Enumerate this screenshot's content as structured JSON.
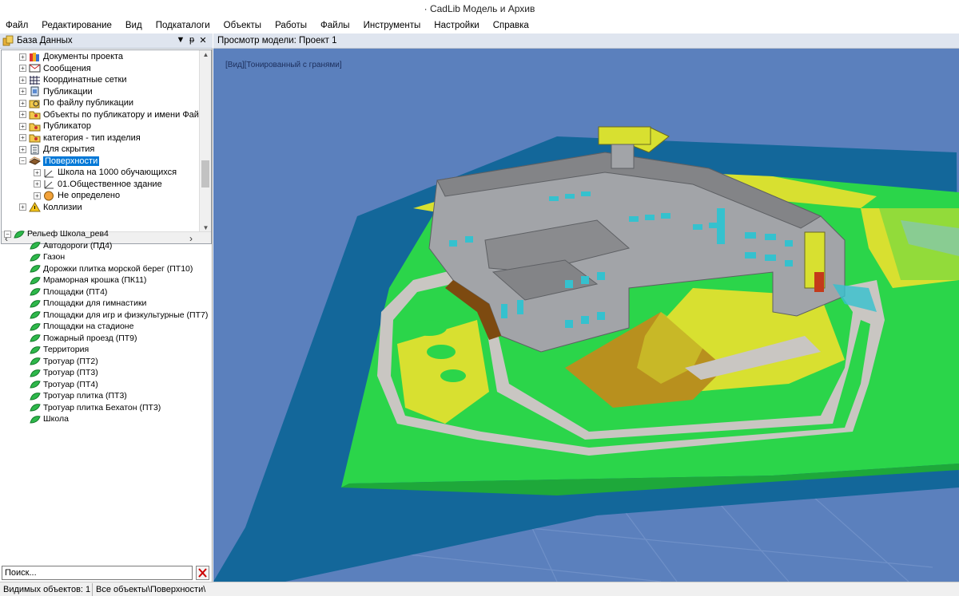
{
  "window": {
    "title": "· CadLib Модель и Архив"
  },
  "menu": [
    "Файл",
    "Редактирование",
    "Вид",
    "Подкаталоги",
    "Объекты",
    "Работы",
    "Файлы",
    "Инструменты",
    "Настройки",
    "Справка"
  ],
  "db_pane": {
    "title": "База Данных",
    "buttons": {
      "dropdown": "▼",
      "pin": "ᵽ",
      "close": "✕"
    },
    "tree": [
      {
        "label": "Документы проекта",
        "icon": "documents-icon"
      },
      {
        "label": "Сообщения",
        "icon": "messages-icon"
      },
      {
        "label": "Координатные сетки",
        "icon": "grid-icon"
      },
      {
        "label": "Публикации",
        "icon": "publications-icon"
      },
      {
        "label": "По файлу публикации",
        "icon": "publication-file-icon"
      },
      {
        "label": "Объекты по публикатору и имени Файла",
        "icon": "folder-key-icon"
      },
      {
        "label": "Публикатор",
        "icon": "folder-key-icon"
      },
      {
        "label": "категория - тип изделия",
        "icon": "folder-key-icon"
      },
      {
        "label": "Для скрытия",
        "icon": "hide-list-icon"
      },
      {
        "label": "Поверхности",
        "icon": "surfaces-icon",
        "selected": true
      },
      {
        "label": "Школа на 1000 обучающихся",
        "icon": "axes-icon"
      },
      {
        "label": "01.Общественное здание",
        "icon": "axes-icon"
      },
      {
        "label": "Не определено",
        "icon": "undefined-icon"
      },
      {
        "label": "Коллизии",
        "icon": "warning-icon"
      }
    ]
  },
  "relief_tree": {
    "root": "Рельеф Школа_рев4",
    "items": [
      "Автодороги (ПД4)",
      "Газон",
      "Дорожки плитка морской берег (ПТ10)",
      "Мраморная крошка (ПК11)",
      "Площадки (ПТ4)",
      "Площадки для гимнастики",
      "Площадки для игр  и физкультурные (ПТ7)",
      "Площадки на стадионе",
      "Пожарный проезд (ПТ9)",
      "Территория",
      "Тротуар (ПТ2)",
      "Тротуар (ПТ3)",
      "Тротуар (ПТ4)",
      "Тротуар плитка (ПТ3)",
      "Тротуар плитка Бехатон (ПТ3)",
      "Школа"
    ]
  },
  "search": {
    "value": "Поиск..."
  },
  "statusbar": {
    "visible": "Видимых объектов: 1",
    "path": "Все объекты\\Поверхности\\"
  },
  "viewport": {
    "title": "Просмотр модели: Проект 1",
    "view_mode": "[Вид][Тонированный с гранями]"
  },
  "colors": {
    "sky": "#5b80bd",
    "water": "#13679a",
    "grass": "#2bd54a",
    "path": "#c9c6c2",
    "yellow": "#d8e030",
    "ochre": "#b8901e",
    "building": "#a2a4a8",
    "roof": "#838487",
    "window": "#35c1ce"
  }
}
